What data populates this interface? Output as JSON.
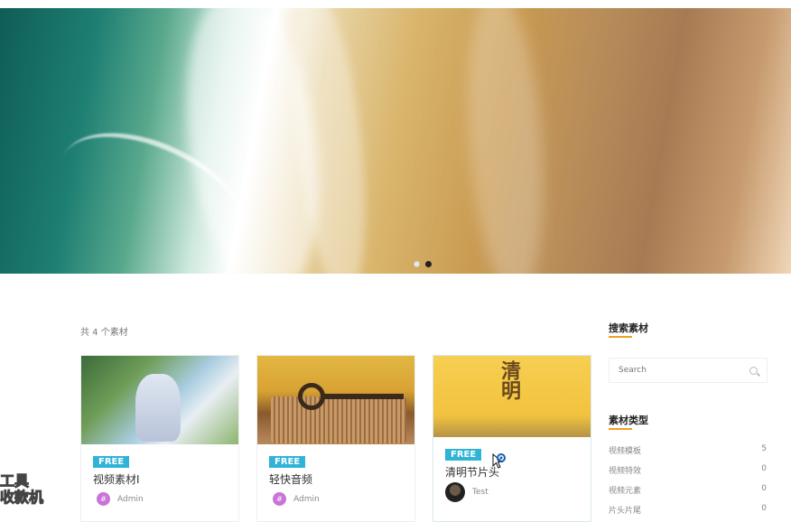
{
  "hero": {
    "slides": 2,
    "active_slide": 2
  },
  "listing": {
    "count_text": "共 4 个素材"
  },
  "cards": [
    {
      "badge": "FREE",
      "title": "视频素材I",
      "author": "Admin",
      "avatar_text": "#"
    },
    {
      "badge": "FREE",
      "title": "轻快音频",
      "author": "Admin",
      "avatar_text": "#"
    },
    {
      "badge": "FREE",
      "title": "清明节片头",
      "author": "Test",
      "thumb_text": "清明"
    }
  ],
  "sidebar": {
    "search_title": "搜索素材",
    "search_placeholder": "Search",
    "category_title": "素材类型",
    "categories": [
      {
        "label": "视频模板",
        "count": "5"
      },
      {
        "label": "视频特效",
        "count": "0"
      },
      {
        "label": "视频元素",
        "count": "0"
      },
      {
        "label": "片头片尾",
        "count": "0"
      }
    ]
  },
  "watermark": {
    "line1": "工具",
    "line2": "收款机"
  },
  "colors": {
    "accent": "#f0a020",
    "badge": "#2fb3d6"
  }
}
